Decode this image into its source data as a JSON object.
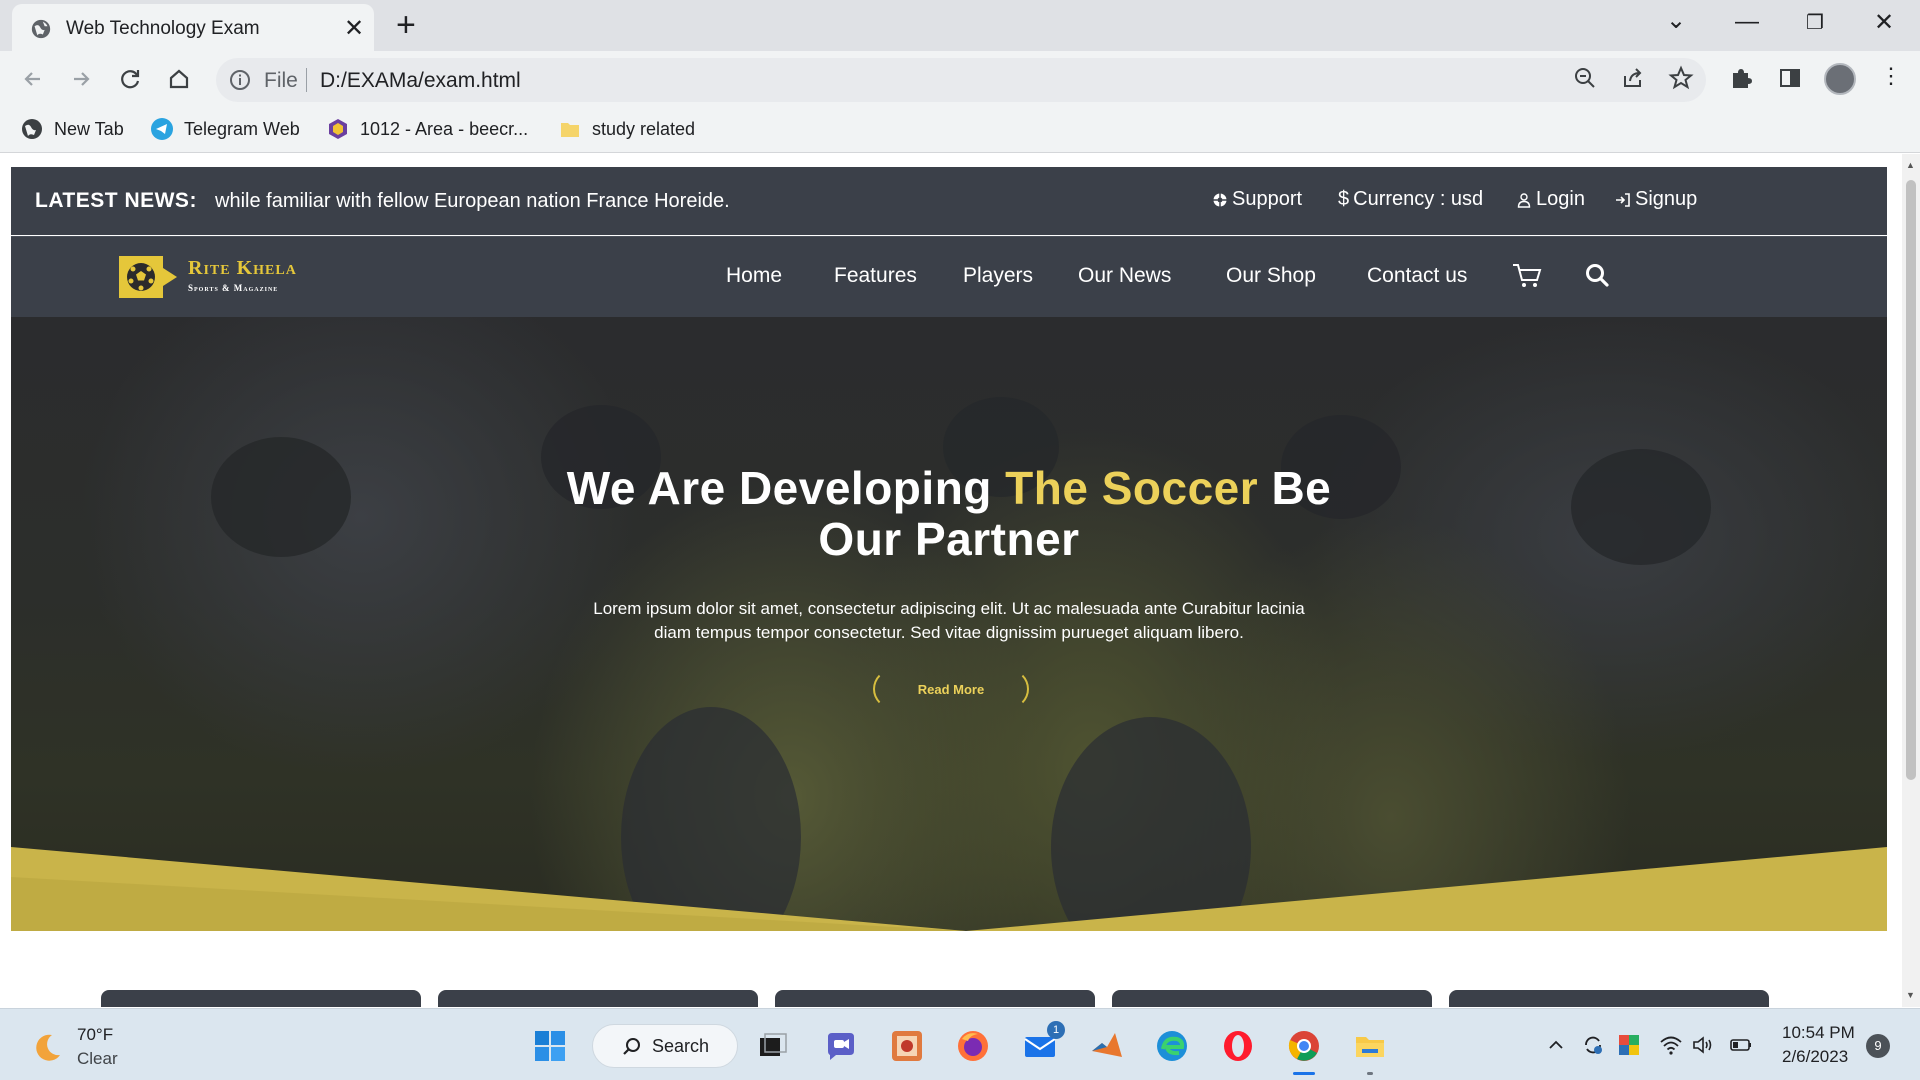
{
  "browser": {
    "tab_title": "Web Technology Exam",
    "url_scheme_label": "File",
    "url": "D:/EXAMa/exam.html",
    "bookmarks": [
      {
        "label": "New Tab",
        "icon": "globe-icon"
      },
      {
        "label": "Telegram Web",
        "icon": "telegram-icon"
      },
      {
        "label": "1012 - Area - beecr...",
        "icon": "beecrowd-icon"
      },
      {
        "label": "study related",
        "icon": "folder-icon"
      }
    ]
  },
  "site": {
    "news_label": "LATEST NEWS:",
    "news_text": "while familiar with fellow European nation France Horeide.",
    "top_links": {
      "support": "Support",
      "currency": "Currency : usd",
      "login": "Login",
      "signup": "Signup"
    },
    "logo": {
      "title": "Rite Khela",
      "subtitle": "Sports & Magazine"
    },
    "menu": [
      "Home",
      "Features",
      "Players",
      "Our News",
      "Our Shop",
      "Contact us"
    ],
    "hero": {
      "title_part1": "We Are Developing ",
      "title_highlight": "The Soccer",
      "title_part2": " Be",
      "title_line2": "Our Partner",
      "text": "Lorem ipsum dolor sit amet, consectetur adipiscing elit. Ut ac malesuada ante Curabitur lacinia diam tempus tempor consectetur. Sed vitae dignissim purueget aliquam libero.",
      "button": "Read More"
    },
    "colors": {
      "accent": "#ecd15a",
      "bar": "#3b4049",
      "hero_band": "#c9b44a"
    }
  },
  "taskbar": {
    "temperature": "70°F",
    "condition": "Clear",
    "search_label": "Search",
    "mail_badge": "1",
    "time": "10:54 PM",
    "date": "2/6/2023",
    "notifications": "9"
  }
}
